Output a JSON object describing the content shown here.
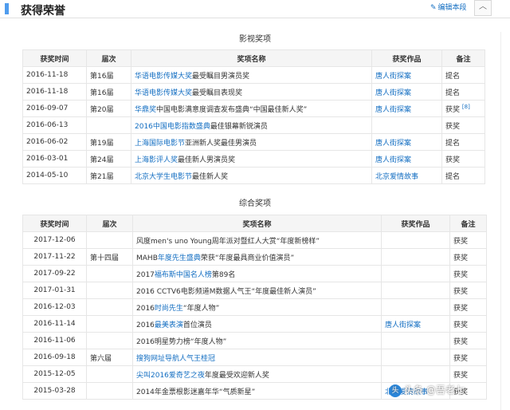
{
  "section": {
    "title": "获得荣誉",
    "edit_label": "编辑本段",
    "collapse_glyph": "︿"
  },
  "film_awards": {
    "caption": "影视奖项",
    "headers": [
      "获奖时间",
      "届次",
      "奖项名称",
      "获奖作品",
      "备注"
    ],
    "rows": [
      {
        "date": "2016-11-18",
        "session": "第16届",
        "award_link": "华语电影传媒大奖",
        "award_text": "最受瞩目男演员奖",
        "work": "唐人街探案",
        "note": "提名",
        "ref": ""
      },
      {
        "date": "2016-11-18",
        "session": "第16届",
        "award_link": "华语电影传媒大奖",
        "award_text": "最受瞩目表现奖",
        "work": "唐人街探案",
        "note": "提名",
        "ref": ""
      },
      {
        "date": "2016-09-07",
        "session": "第20届",
        "award_link": "华鼎奖",
        "award_text": "中国电影满意度调查发布盛典“中国最佳新人奖”",
        "work": "唐人街探案",
        "note": "获奖",
        "ref": "[8]"
      },
      {
        "date": "2016-06-13",
        "session": "",
        "award_link": "2016中国电影指数盛典",
        "award_text": "最佳银幕新锐演员",
        "work": "",
        "note": "获奖",
        "ref": ""
      },
      {
        "date": "2016-06-02",
        "session": "第19届",
        "award_link": "上海国际电影节",
        "award_text": "亚洲新人奖最佳男演员",
        "work": "唐人街探案",
        "note": "提名",
        "ref": ""
      },
      {
        "date": "2016-03-01",
        "session": "第24届",
        "award_link": "上海影评人奖",
        "award_text": "最佳新人男演员奖",
        "work": "唐人街探案",
        "note": "获奖",
        "ref": ""
      },
      {
        "date": "2014-05-10",
        "session": "第21届",
        "award_link": "北京大学生电影节",
        "award_text": "最佳新人奖",
        "work": "北京爱情故事",
        "note": "提名",
        "ref": ""
      }
    ]
  },
  "general_awards": {
    "caption": "综合奖项",
    "headers": [
      "获奖时间",
      "届次",
      "奖项名称",
      "获奖作品",
      "备注"
    ],
    "rows": [
      {
        "date": "2017-12-06",
        "session": "",
        "pre": "风度men's uno Young周年派对暨红人大赏“年度新榜样”",
        "link": "",
        "post": "",
        "work": "",
        "note": "获奖"
      },
      {
        "date": "2017-11-22",
        "session": "第十四届",
        "pre": "MAHB",
        "link": "年度先生盛典",
        "post": "荣获“年度最具商业价值演员”",
        "work": "",
        "note": "获奖"
      },
      {
        "date": "2017-09-22",
        "session": "",
        "pre": "2017",
        "link": "福布斯中国名人榜",
        "post": "第89名",
        "work": "",
        "note": "获奖"
      },
      {
        "date": "2017-01-31",
        "session": "",
        "pre": "2016 CCTV6电影频道M数据人气王“年度最佳新人演员”",
        "link": "",
        "post": "",
        "work": "",
        "note": "获奖"
      },
      {
        "date": "2016-12-03",
        "session": "",
        "pre": "2016",
        "link": "时尚先生",
        "post": "“年度人物”",
        "work": "",
        "note": "获奖"
      },
      {
        "date": "2016-11-14",
        "session": "",
        "pre": "2016",
        "link": "最美表演",
        "post": "首位演员",
        "work": "唐人街探案",
        "note": "获奖"
      },
      {
        "date": "2016-11-06",
        "session": "",
        "pre": "2016明星势力榜“年度人物”",
        "link": "",
        "post": "",
        "work": "",
        "note": "获奖"
      },
      {
        "date": "2016-09-18",
        "session": "第六届",
        "pre": "",
        "link": "搜狗网址导航人气王桂冠",
        "post": "",
        "work": "",
        "note": "获奖"
      },
      {
        "date": "2015-12-05",
        "session": "",
        "pre": "",
        "link": "尖叫2016爱奇艺之夜",
        "post": "年度最受欢迎新人奖",
        "work": "",
        "note": "获奖"
      },
      {
        "date": "2015-03-28",
        "session": "",
        "pre": "2014年金票根影迷嘉年华“气质新星”",
        "link": "",
        "post": "",
        "work": "北京爱情故事",
        "note": "获奖"
      }
    ]
  },
  "watermark": {
    "logo": "头",
    "text": "头条 @吾老七"
  }
}
